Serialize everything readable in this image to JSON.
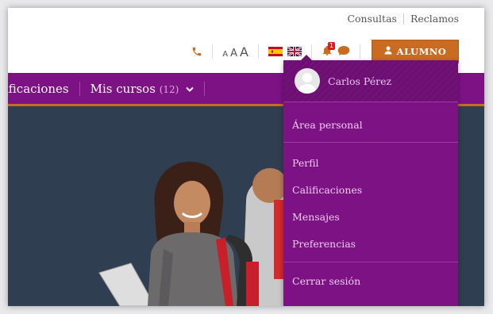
{
  "toplinks": {
    "consultas": "Consultas",
    "reclamos": "Reclamos"
  },
  "tools": {
    "phone_icon": "phone-icon",
    "font_sizes": [
      "A",
      "A",
      "A"
    ],
    "notifications_count": "1",
    "notifications_icon": "bell-icon",
    "messages_icon": "chat-icon",
    "user_button": "ALUMNO",
    "user_icon": "user-icon"
  },
  "navbar": {
    "items": [
      {
        "label": "ificaciones"
      },
      {
        "label": "Mis cursos",
        "count": "(12)"
      }
    ]
  },
  "dropdown": {
    "user_name": "Carlos Pérez",
    "sections": [
      [
        "Área personal"
      ],
      [
        "Perfil",
        "Calificaciones",
        "Mensajes",
        "Preferencias"
      ],
      [
        "Cerrar sesión"
      ]
    ]
  },
  "colors": {
    "brand_purple": "#7d1285",
    "accent_orange": "#c96c21",
    "hero_bg": "#2f3f51"
  }
}
